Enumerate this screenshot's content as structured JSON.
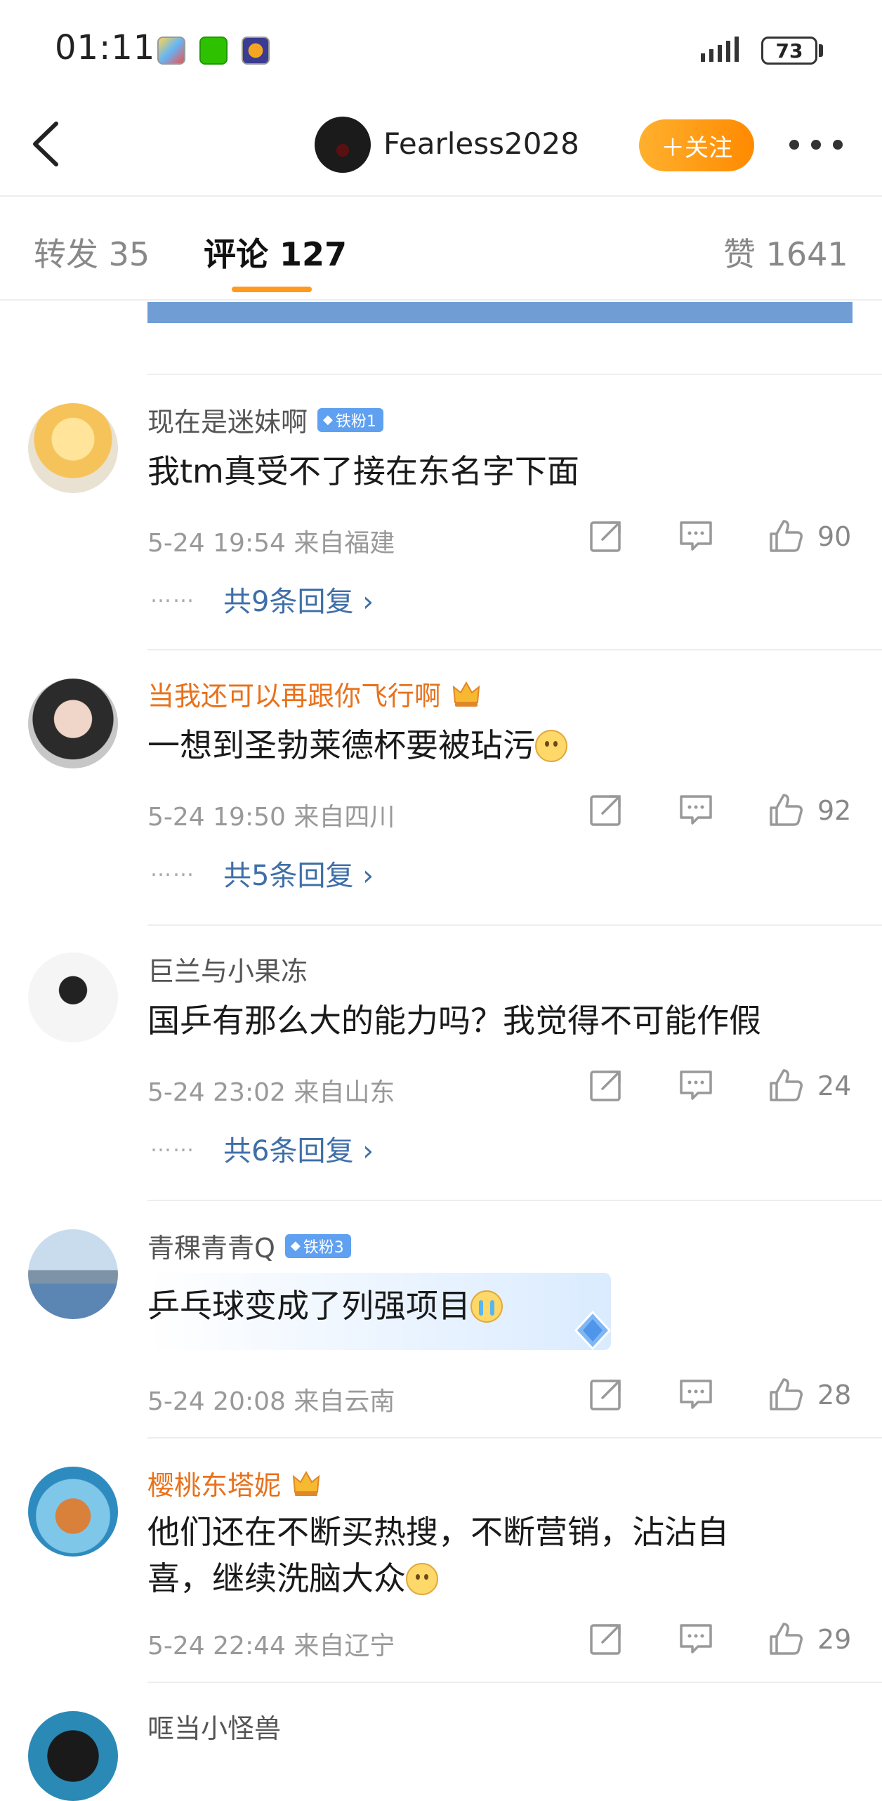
{
  "status_bar": {
    "time": "01:11",
    "battery": "73"
  },
  "header": {
    "username": "Fearless2028",
    "follow_label": "＋关注"
  },
  "tabs": {
    "repost": "转发 35",
    "comments": "评论 127",
    "likes": "赞 1641"
  },
  "comments": [
    {
      "user": "现在是迷妹啊",
      "badge": "铁粉1",
      "text": "我tm真受不了接在东名字下面",
      "time": "5-24 19:54",
      "location": "来自福建",
      "likes": "90",
      "replies": "共9条回复"
    },
    {
      "user": "当我还可以再跟你飞行啊",
      "text": "一想到圣勃莱德杯要被玷污",
      "time": "5-24 19:50",
      "location": "来自四川",
      "likes": "92",
      "replies": "共5条回复"
    },
    {
      "user": "巨兰与小果冻",
      "text": "国乒有那么大的能力吗？我觉得不可能作假",
      "time": "5-24 23:02",
      "location": "来自山东",
      "likes": "24",
      "replies": "共6条回复"
    },
    {
      "user": "青稞青青Q",
      "badge": "铁粉3",
      "text": "乒乓球变成了列强项目",
      "time": "5-24 20:08",
      "location": "来自云南",
      "likes": "28"
    },
    {
      "user": "樱桃东塔妮",
      "text_line1": "他们还在不断买热搜，不断营销，沾沾自",
      "text_line2": "喜，继续洗脑大众",
      "time": "5-24 22:44",
      "location": "来自辽宁",
      "likes": "29"
    },
    {
      "user": "哐当小怪兽"
    }
  ],
  "colors": {
    "accent": "#ff9a1f",
    "link": "#3f6fa8",
    "vip_name": "#e8711b",
    "badge": "#5fa0f0"
  }
}
